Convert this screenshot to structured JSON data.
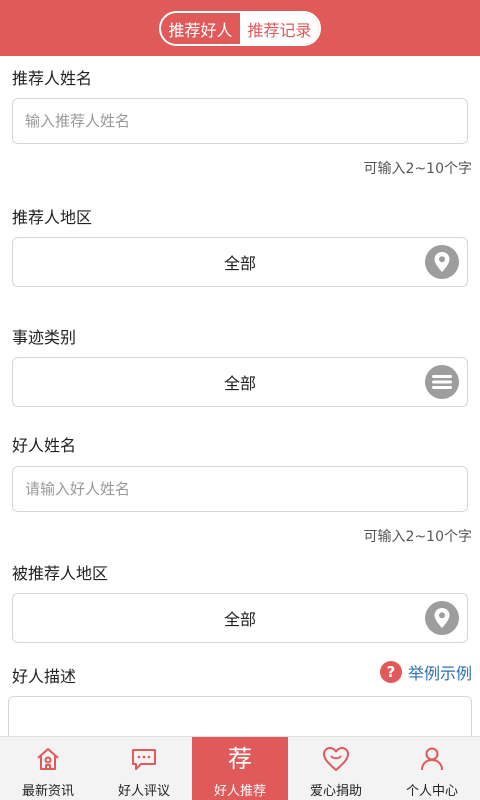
{
  "header": {
    "tabs": [
      {
        "label": "推荐好人"
      },
      {
        "label": "推荐记录"
      }
    ]
  },
  "form": {
    "recommender_name": {
      "label": "推荐人姓名",
      "placeholder": "输入推荐人姓名",
      "value": "",
      "hint": "可输入2~10个字"
    },
    "recommender_region": {
      "label": "推荐人地区",
      "value": "全部",
      "icon": "location-pin-icon"
    },
    "deed_category": {
      "label": "事迹类别",
      "value": "全部",
      "icon": "menu-list-icon"
    },
    "good_person_name": {
      "label": "好人姓名",
      "placeholder": "请输入好人姓名",
      "value": "",
      "hint": "可输入2~10个字"
    },
    "recommended_region": {
      "label": "被推荐人地区",
      "value": "全部",
      "icon": "location-pin-icon"
    },
    "description": {
      "label": "好人描述",
      "example_label": "举例示例",
      "example_icon_text": "?",
      "value": ""
    }
  },
  "tabbar": {
    "items": [
      {
        "label": "最新资讯",
        "icon": "house-icon"
      },
      {
        "label": "好人评议",
        "icon": "chat-bubble-icon"
      },
      {
        "label": "好人推荐",
        "icon_text": "荐"
      },
      {
        "label": "爱心捐助",
        "icon": "heart-icon"
      },
      {
        "label": "个人中心",
        "icon": "person-icon"
      }
    ]
  },
  "colors": {
    "accent": "#e05a5a",
    "link": "#2a6fb4",
    "icon_gray": "#9d9d9d"
  }
}
